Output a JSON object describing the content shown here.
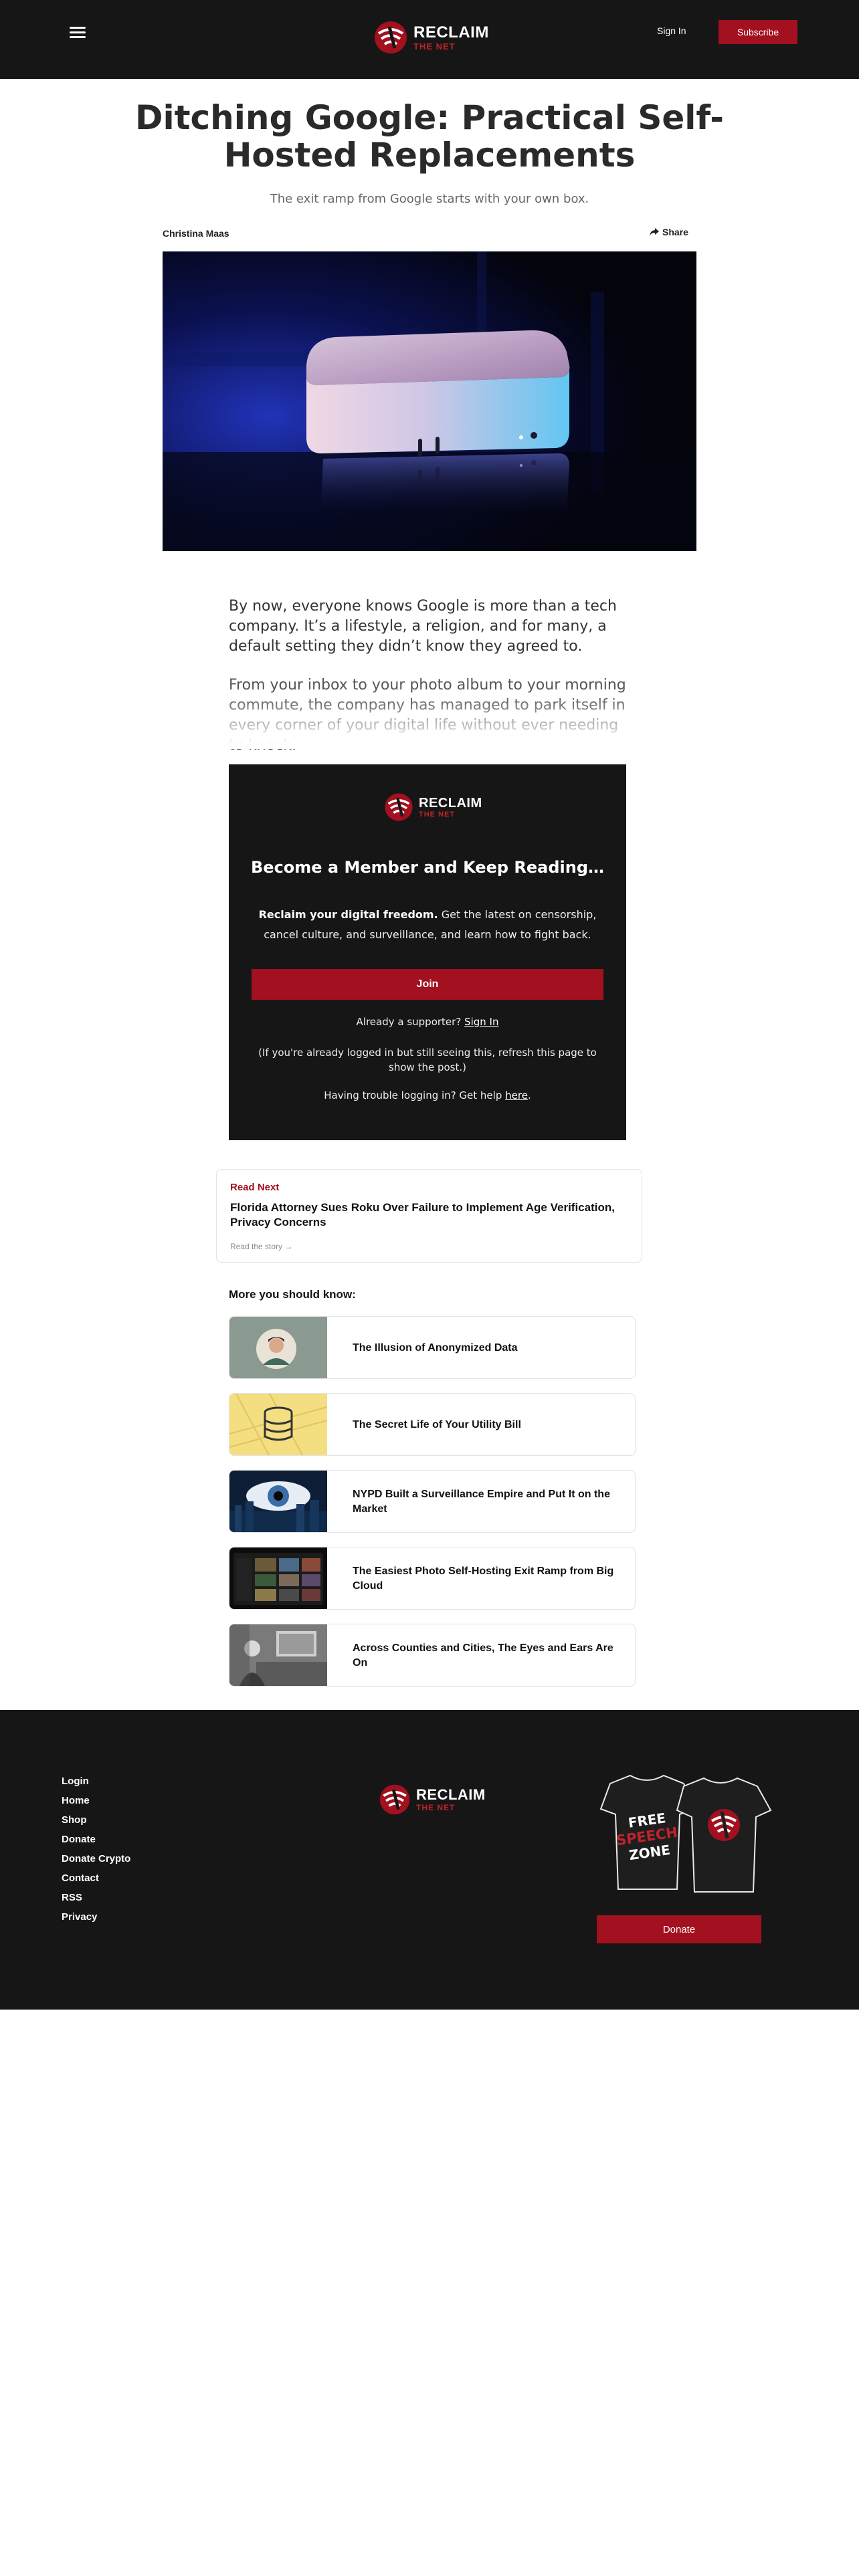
{
  "brand": {
    "line1": "RECLAIM",
    "line2": "THE NET",
    "accent": "#a3101f"
  },
  "header": {
    "signin_label": "Sign In",
    "subscribe_label": "Subscribe"
  },
  "article": {
    "title": "Ditching Google: Practical Self-Hosted Replacements",
    "subtitle": "The exit ramp from Google starts with your own box.",
    "author": "Christina Maas",
    "share_label": "Share",
    "paragraphs": [
      "By now, everyone knows Google is more than a tech company. It’s a lifestyle, a religion, and for many, a default setting they didn’t know they agreed to.",
      "From your inbox to your photo album to your morning commute, the company has managed to park itself in every corner of your digital life without ever needing to knock."
    ]
  },
  "paywall": {
    "heading": "Become a Member and Keep Reading…",
    "desc_bold": "Reclaim your digital freedom.",
    "desc_rest": " Get the latest on censorship, cancel culture, and surveillance, and learn how to fight back.",
    "join_label": "Join",
    "supporter_text": "Already a supporter? ",
    "supporter_link": "Sign In",
    "refresh_note": "(If you're already logged in but still seeing this, refresh this page to show the post.)",
    "trouble_text": "Having trouble logging in? Get help ",
    "trouble_link": "here",
    "trouble_end": "."
  },
  "read_next": {
    "label": "Read Next",
    "title": "Florida Attorney Sues Roku Over Failure to Implement Age Verification, Privacy Concerns",
    "link": "Read the story →"
  },
  "more": {
    "heading": "More you should know:",
    "items": [
      {
        "title": "The Illusion of Anonymized Data"
      },
      {
        "title": "The Secret Life of Your Utility Bill"
      },
      {
        "title": "NYPD Built a Surveillance Empire and Put It on the Market"
      },
      {
        "title": "The Easiest Photo Self-Hosting Exit Ramp from Big Cloud"
      },
      {
        "title": "Across Counties and Cities, The Eyes and Ears Are On"
      }
    ]
  },
  "footer": {
    "links": [
      "Login",
      "Home",
      "Shop",
      "Donate",
      "Donate Crypto",
      "Contact",
      "RSS",
      "Privacy"
    ],
    "shirt_text": {
      "line1": "FREE",
      "line2": "SPEECH",
      "line3": "ZONE"
    },
    "donate_label": "Donate"
  }
}
